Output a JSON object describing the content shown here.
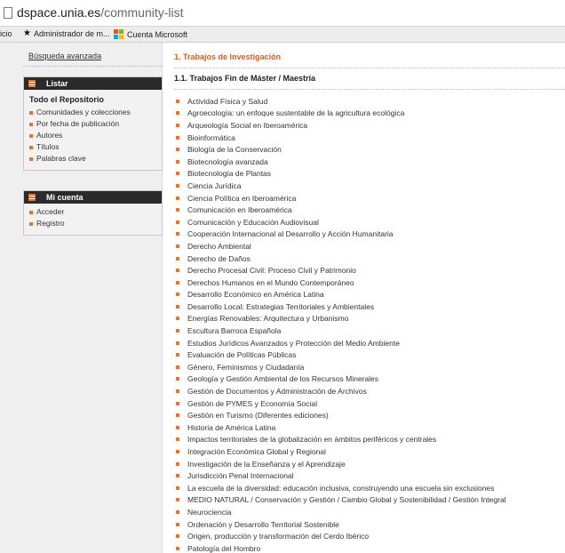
{
  "browser": {
    "url_host": "dspace.unia.es",
    "url_path": "/community-list",
    "bookmarks": [
      {
        "label": "icio",
        "icon": "none"
      },
      {
        "label": "Administrador de m...",
        "icon": "star-icon"
      },
      {
        "label": "Cuenta Microsoft",
        "icon": "microsoft-logo-icon"
      }
    ]
  },
  "colors": {
    "accent": "#f36f21",
    "heading": "#e05a1a",
    "panel_header": "#2b2b2b"
  },
  "sidebar": {
    "advanced_search": "Búsqueda avanzada",
    "browse": {
      "title": "Listar",
      "subtitle": "Todo el Repositorio",
      "items": [
        "Comunidades y colecciones",
        "Por fecha de publicación",
        "Autores",
        "Títulos",
        "Palabras clave"
      ]
    },
    "account": {
      "title": "Mi cuenta",
      "items": [
        "Acceder",
        "Registro"
      ]
    }
  },
  "main": {
    "heading": "1. Trabajos de Investigación",
    "subheading": "1.1. Trabajos Fin de Máster / Maestría",
    "items": [
      "Actividad Física y Salud",
      "Agroecología: un enfoque sustentable de la agricultura ecológica",
      "Arqueología Social en Iberoamérica",
      "Bioinformática",
      "Biología de la Conservación",
      "Biotecnología avanzada",
      "Biotecnología de Plantas",
      "Ciencia Jurídica",
      "Ciencia Política en Iberoamérica",
      "Comunicación en Iberoamérica",
      "Comunicación y Educación Audiovisual",
      "Cooperación Internacional al Desarrollo y Acción Humanitaria",
      "Derecho Ambiental",
      "Derecho de Daños",
      "Derecho Procesal Civil: Proceso Civil y Patrimonio",
      "Derechos Humanos en el Mundo Contemporáneo",
      "Desarrollo Económico en América Latina",
      "Desarrollo Local: Estrategias Territoriales y Ambientales",
      "Energías Renovables: Arquitectura y Urbanismo",
      "Escultura Barroca Española",
      "Estudios Jurídicos Avanzados y Protección del Medio Ambiente",
      "Evaluación de Políticas Públicas",
      "Género, Feminismos y Ciudadanía",
      "Geología y Gestión Ambiental de los Recursos Minerales",
      "Gestión de Documentos y Administración de Archivos",
      "Gestión de PYMES y Economía Social",
      "Gestión en Turismo (Diferentes ediciones)",
      "Historia de América Latina",
      "Impactos territoriales de la globalización en ámbitos periféricos y centrales",
      "Integración Económica Global y Regional",
      "Investigación de la Enseñanza y el Aprendizaje",
      "Jurisdicción Penal Internacional",
      "La escuela de la diversidad: educación inclusiva, construyendo una escuela sin exclusiones",
      "MEDIO NATURAL / Conservación y Gestión / Cambio Global y Sostenibilidad / Gestión Integral",
      "Neurociencia",
      "Ordenación y Desarrollo Territorial Sostenible",
      "Origen, producción y transformación del Cerdo Ibérico",
      "Patología del Hombro"
    ]
  }
}
